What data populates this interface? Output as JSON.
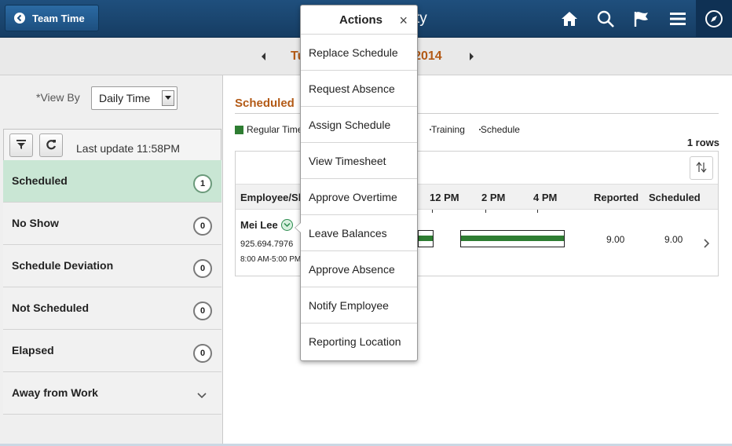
{
  "header": {
    "back_label": "Team Time",
    "title": "Weekly Availability",
    "icons": [
      "home-icon",
      "search-icon",
      "flag-icon",
      "menu-icon",
      "navigator-icon"
    ]
  },
  "datebar": {
    "label": "Tuesday, August 12, 2014"
  },
  "sidebar": {
    "view_by_label": "*View By",
    "view_by_value": "Daily Time",
    "last_update": "Last update 11:58PM",
    "categories": [
      {
        "label": "Scheduled",
        "count": "1",
        "active": true
      },
      {
        "label": "No Show",
        "count": "0"
      },
      {
        "label": "Schedule Deviation",
        "count": "0"
      },
      {
        "label": "Not Scheduled",
        "count": "0"
      },
      {
        "label": "Elapsed",
        "count": "0"
      },
      {
        "label": "Away from Work",
        "count": ""
      }
    ]
  },
  "main": {
    "section_title": "Scheduled",
    "legend": [
      {
        "label": "Regular Time",
        "color": "#2e7d32"
      },
      {
        "label": "Training",
        "pattern": "hatched"
      },
      {
        "label": "Schedule",
        "color": "#ffffff"
      }
    ],
    "rows_count": "1 rows",
    "columns": [
      "Employee/Shift",
      "12 PM",
      "2 PM",
      "4 PM",
      "Reported",
      "Scheduled"
    ],
    "rows": [
      {
        "name": "Mei Lee",
        "phone": "925.694.7976",
        "shift": "8:00 AM-5:00 PM",
        "reported": "9.00",
        "scheduled": "9.00"
      }
    ]
  },
  "popup": {
    "title": "Actions",
    "close": "×",
    "items": [
      "Replace Schedule",
      "Request Absence",
      "Assign Schedule",
      "View Timesheet",
      "Approve Overtime",
      "Leave Balances",
      "Approve Absence",
      "Notify Employee",
      "Reporting Location"
    ]
  },
  "colors": {
    "header": "#1f4f7d",
    "accent": "#b35a16",
    "active_row": "#c9e6d4",
    "bar": "#2e7d32"
  }
}
